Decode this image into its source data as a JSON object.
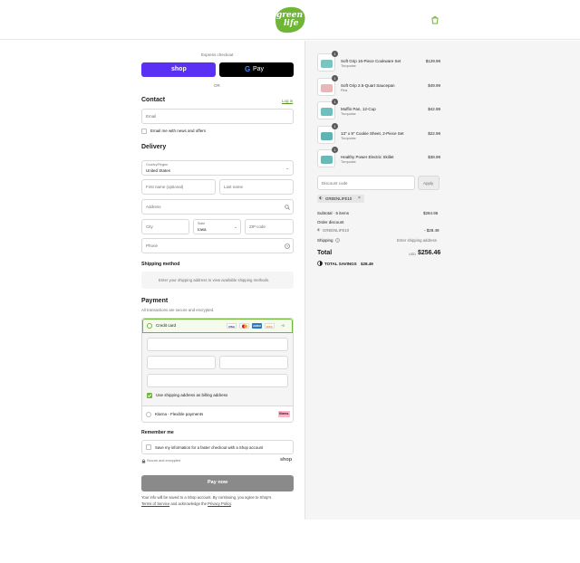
{
  "header": {
    "logo_line1": "green",
    "logo_line2": "life",
    "brand_color": "#6fb536",
    "cart_icon": "shopping-bag-icon"
  },
  "express": {
    "label": "Express checkout",
    "shop_label": "shop",
    "gpay_label": "Pay",
    "or_label": "OR"
  },
  "contact": {
    "title": "Contact",
    "login_label": "Log in",
    "email_placeholder": "Email",
    "news_label": "Email me with news and offers"
  },
  "delivery": {
    "title": "Delivery",
    "country_label": "Country/Region",
    "country_value": "United States",
    "first_name_placeholder": "First name (optional)",
    "last_name_placeholder": "Last name",
    "address_placeholder": "Address",
    "city_placeholder": "City",
    "state_label": "State",
    "state_value": "Iowa",
    "zip_placeholder": "ZIP code",
    "phone_placeholder": "Phone"
  },
  "shipping": {
    "title": "Shipping method",
    "message": "Enter your shipping address to view available shipping methods."
  },
  "payment": {
    "title": "Payment",
    "subtitle": "All transactions are secure and encrypted.",
    "credit_card_label": "Credit card",
    "card_brands": [
      "VISA",
      "MC",
      "AMEX",
      "DISC"
    ],
    "more_cards": "+5",
    "billing_label": "Use shipping address as billing address",
    "klarna_label": "Klarna - Flexible payments",
    "klarna_badge": "Klarna."
  },
  "remember": {
    "title": "Remember me",
    "save_label": "Save my information for a faster checkout with a Shop account",
    "secure_label": "Secure and encrypted",
    "shop_label": "shop"
  },
  "pay_button": "Pay now",
  "footer": {
    "text1": "Your info will be saved to a Shop account. By continuing, you agree to Shop's",
    "terms": "Terms of Service",
    "text2": "and acknowledge the",
    "privacy": "Privacy Policy",
    "text3": "."
  },
  "cart": {
    "items": [
      {
        "name": "Soft Grip 16-Piece Cookware Set",
        "variant": "Turquoise",
        "price": "$129.99",
        "qty": "1",
        "swatch": "#7cc4c2"
      },
      {
        "name": "Soft Grip 2.5-Quart Saucepan",
        "variant": "Pink",
        "price": "$49.99",
        "qty": "1",
        "swatch": "#e9b7b7"
      },
      {
        "name": "Muffin Pan, 12-Cup",
        "variant": "Turquoise",
        "price": "$42.99",
        "qty": "1",
        "swatch": "#6fbfbe"
      },
      {
        "name": "13\" x 9\" Cookie Sheet, 2-Piece Set",
        "variant": "Turquoise",
        "price": "$22.99",
        "qty": "1",
        "swatch": "#5fb3b3"
      },
      {
        "name": "Healthy Power Electric Skillet",
        "variant": "Turquoise",
        "price": "$38.99",
        "qty": "1",
        "swatch": "#69b9b6"
      }
    ],
    "discount_placeholder": "Discount code",
    "apply_label": "Apply",
    "discount_tag": "GREENLIFE10",
    "subtotal_label": "Subtotal · 5 items",
    "subtotal_value": "$284.95",
    "order_discount_label": "Order discount",
    "order_discount_code": "GREENLIFE10",
    "order_discount_value": "- $28.49",
    "shipping_label": "Shipping",
    "shipping_value": "Enter shipping address",
    "total_label": "Total",
    "currency": "USD",
    "total_value": "$256.46",
    "savings_label": "TOTAL SAVINGS",
    "savings_value": "$28.49"
  }
}
